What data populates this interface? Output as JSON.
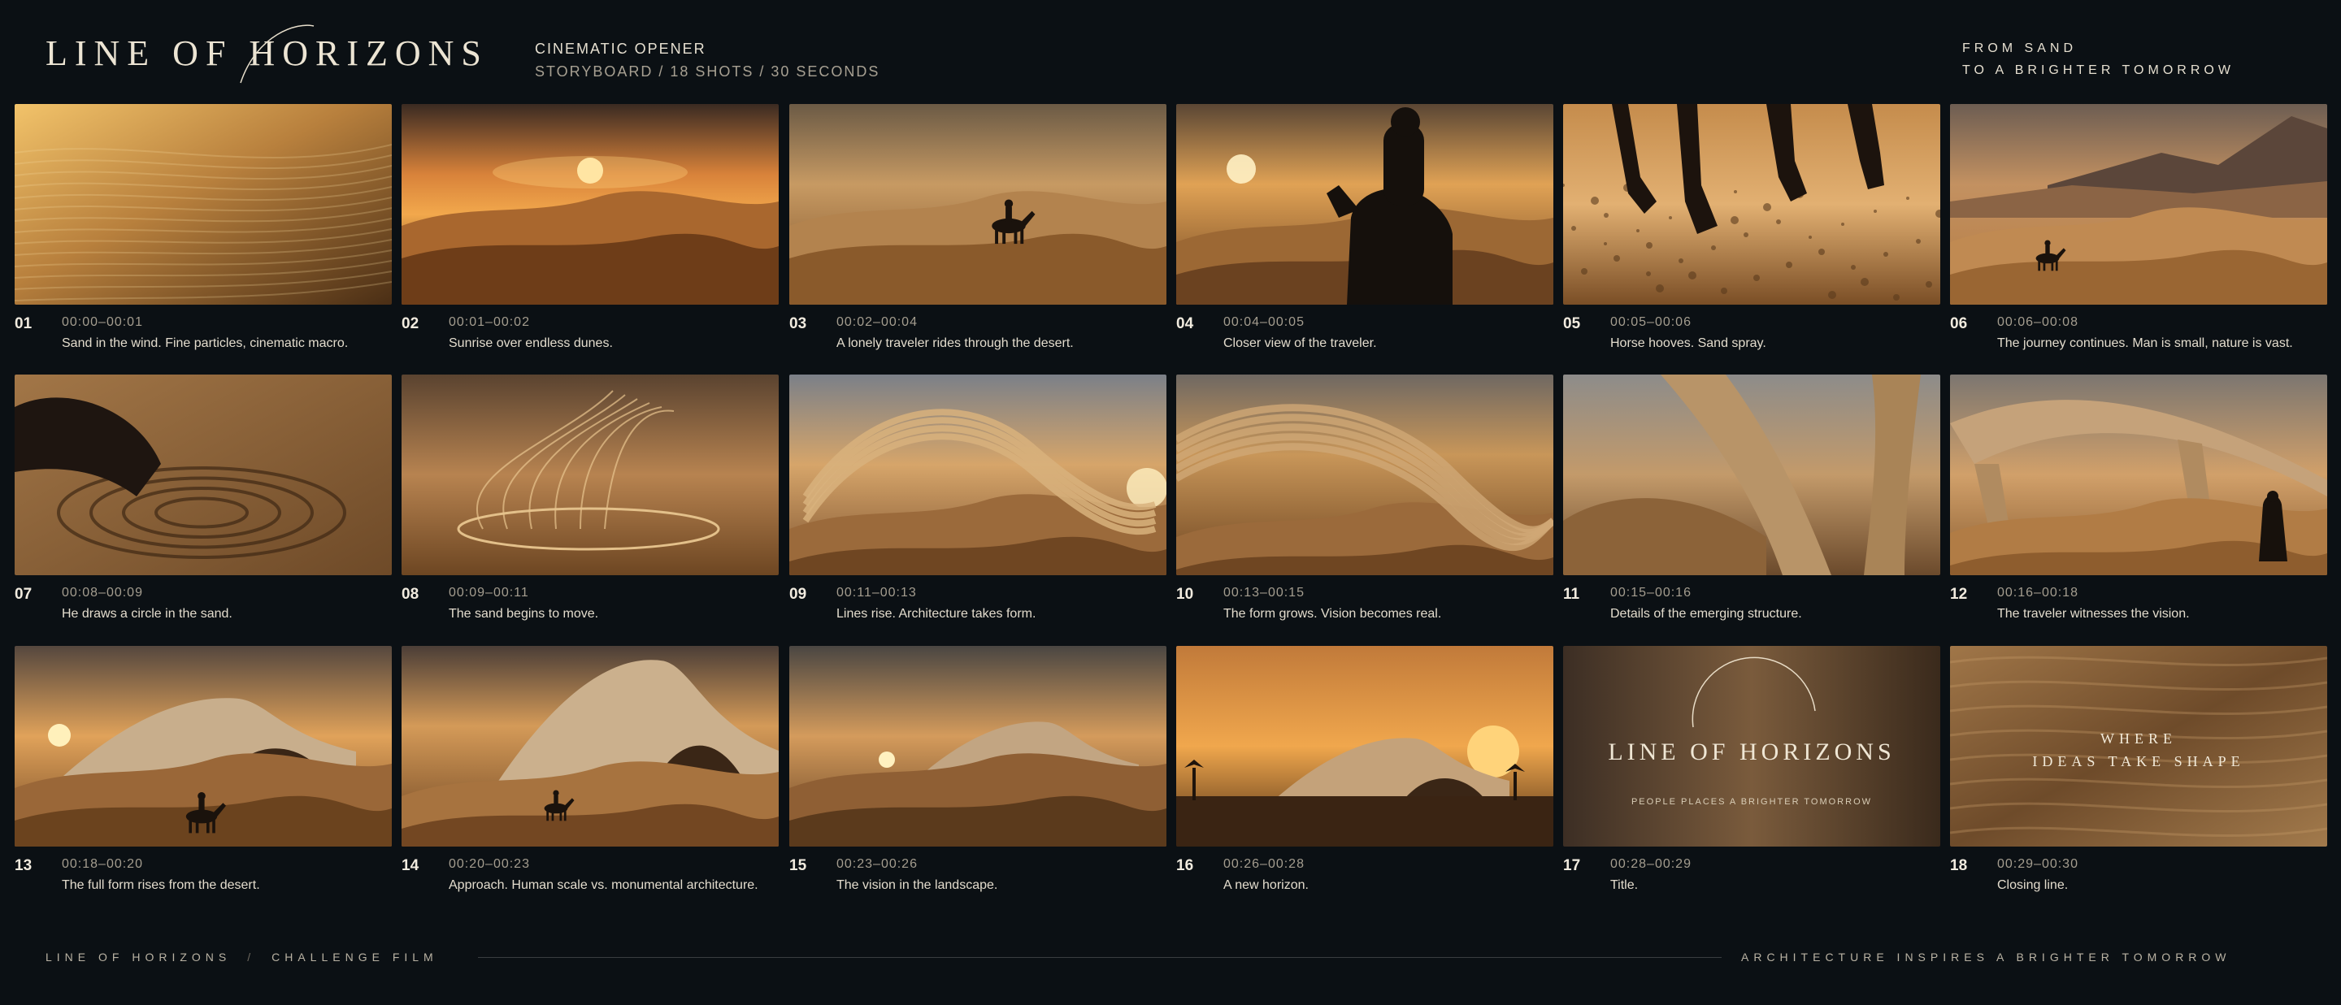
{
  "header": {
    "logo": "LINE OF HORIZONS",
    "subtitle_line1": "CINEMATIC OPENER",
    "subtitle_line2": "STORYBOARD / 18 SHOTS / 30 SECONDS",
    "tagline_line1": "FROM SAND",
    "tagline_line2": "TO A BRIGHTER TOMORROW"
  },
  "shots": [
    {
      "num": "01",
      "time": "00:00–00:01",
      "desc": "Sand in the wind. Fine particles, cinematic macro.",
      "scene": "sand-macro"
    },
    {
      "num": "02",
      "time": "00:01–00:02",
      "desc": "Sunrise over endless dunes.",
      "scene": "sunrise-dunes"
    },
    {
      "num": "03",
      "time": "00:02–00:04",
      "desc": "A lonely traveler rides through the desert.",
      "scene": "rider-dunes"
    },
    {
      "num": "04",
      "time": "00:04–00:05",
      "desc": "Closer view of the traveler.",
      "scene": "rider-close"
    },
    {
      "num": "05",
      "time": "00:05–00:06",
      "desc": "Horse hooves. Sand spray.",
      "scene": "hooves"
    },
    {
      "num": "06",
      "time": "00:06–00:08",
      "desc": "The journey continues. Man is small, nature is vast.",
      "scene": "mountains-rider"
    },
    {
      "num": "07",
      "time": "00:08–00:09",
      "desc": "He draws a circle in the sand.",
      "scene": "hand-circle"
    },
    {
      "num": "08",
      "time": "00:09–00:11",
      "desc": "The sand begins to move.",
      "scene": "sand-swirl"
    },
    {
      "num": "09",
      "time": "00:11–00:13",
      "desc": "Lines rise. Architecture takes form.",
      "scene": "ribbons"
    },
    {
      "num": "10",
      "time": "00:13–00:15",
      "desc": "The form grows. Vision becomes real.",
      "scene": "ribbons-big"
    },
    {
      "num": "11",
      "time": "00:15–00:16",
      "desc": "Details of the emerging structure.",
      "scene": "structure-detail"
    },
    {
      "num": "12",
      "time": "00:16–00:18",
      "desc": "The traveler witnesses the vision.",
      "scene": "structure-witness"
    },
    {
      "num": "13",
      "time": "00:18–00:20",
      "desc": "The full form rises from the desert.",
      "scene": "building-rider"
    },
    {
      "num": "14",
      "time": "00:20–00:23",
      "desc": "Approach. Human scale vs. monumental architecture.",
      "scene": "building-approach"
    },
    {
      "num": "15",
      "time": "00:23–00:26",
      "desc": "The vision in the landscape.",
      "scene": "building-landscape"
    },
    {
      "num": "16",
      "time": "00:26–00:28",
      "desc": "A new horizon.",
      "scene": "building-sunset"
    },
    {
      "num": "17",
      "time": "00:28–00:29",
      "desc": "Title.",
      "scene": "title-card"
    },
    {
      "num": "18",
      "time": "00:29–00:30",
      "desc": "Closing line.",
      "scene": "closing-card"
    }
  ],
  "title_card": {
    "title": "LINE OF HORIZONS",
    "subtitle": "PEOPLE   PLACES   A BRIGHTER TOMORROW"
  },
  "closing_card": {
    "line1": "WHERE",
    "line2": "IDEAS TAKE SHAPE"
  },
  "footer": {
    "left_title": "LINE OF HORIZONS",
    "separator": "/",
    "left_sub": "CHALLENGE FILM",
    "right": "ARCHITECTURE INSPIRES A BRIGHTER TOMORROW"
  },
  "colors": {
    "background": "#0b1014",
    "accent_gold": "#d99a45",
    "sand": "#b98550",
    "text": "#e3dccd"
  }
}
